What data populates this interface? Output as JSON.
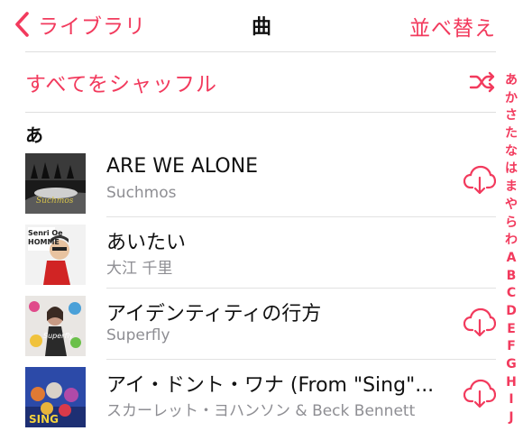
{
  "nav": {
    "back_label": "ライブラリ",
    "title": "曲",
    "sort_label": "並べ替え"
  },
  "shuffle_label": "すべてをシャッフル",
  "section_header": "あ",
  "songs": [
    {
      "title": "ARE WE ALONE",
      "artist": "Suchmos",
      "cloud": true
    },
    {
      "title": "あいたい",
      "artist": "大江 千里",
      "cloud": false
    },
    {
      "title": "アイデンティティの行方",
      "artist": "Superfly",
      "cloud": true
    },
    {
      "title": "アイ・ドント・ワナ (From \"Sing\"...",
      "artist": "スカーレット・ヨハンソン & Beck Bennett",
      "cloud": true
    }
  ],
  "art_text": {
    "suchmos": "Suchmos",
    "senri_1": "Senri Oe",
    "senri_2": "HOMME",
    "superfly": "Superfly",
    "sing": "SING"
  },
  "index": [
    "あ",
    "か",
    "さ",
    "た",
    "な",
    "は",
    "ま",
    "や",
    "ら",
    "わ",
    "A",
    "B",
    "C",
    "D",
    "E",
    "F",
    "G",
    "H",
    "I",
    "J"
  ],
  "colors": {
    "accent": "#f23a5d",
    "secondary_text": "#8e8e93",
    "separator": "#dedede"
  },
  "icons": {
    "back": "chevron-left-icon",
    "shuffle": "shuffle-icon",
    "cloud": "cloud-download-icon"
  }
}
